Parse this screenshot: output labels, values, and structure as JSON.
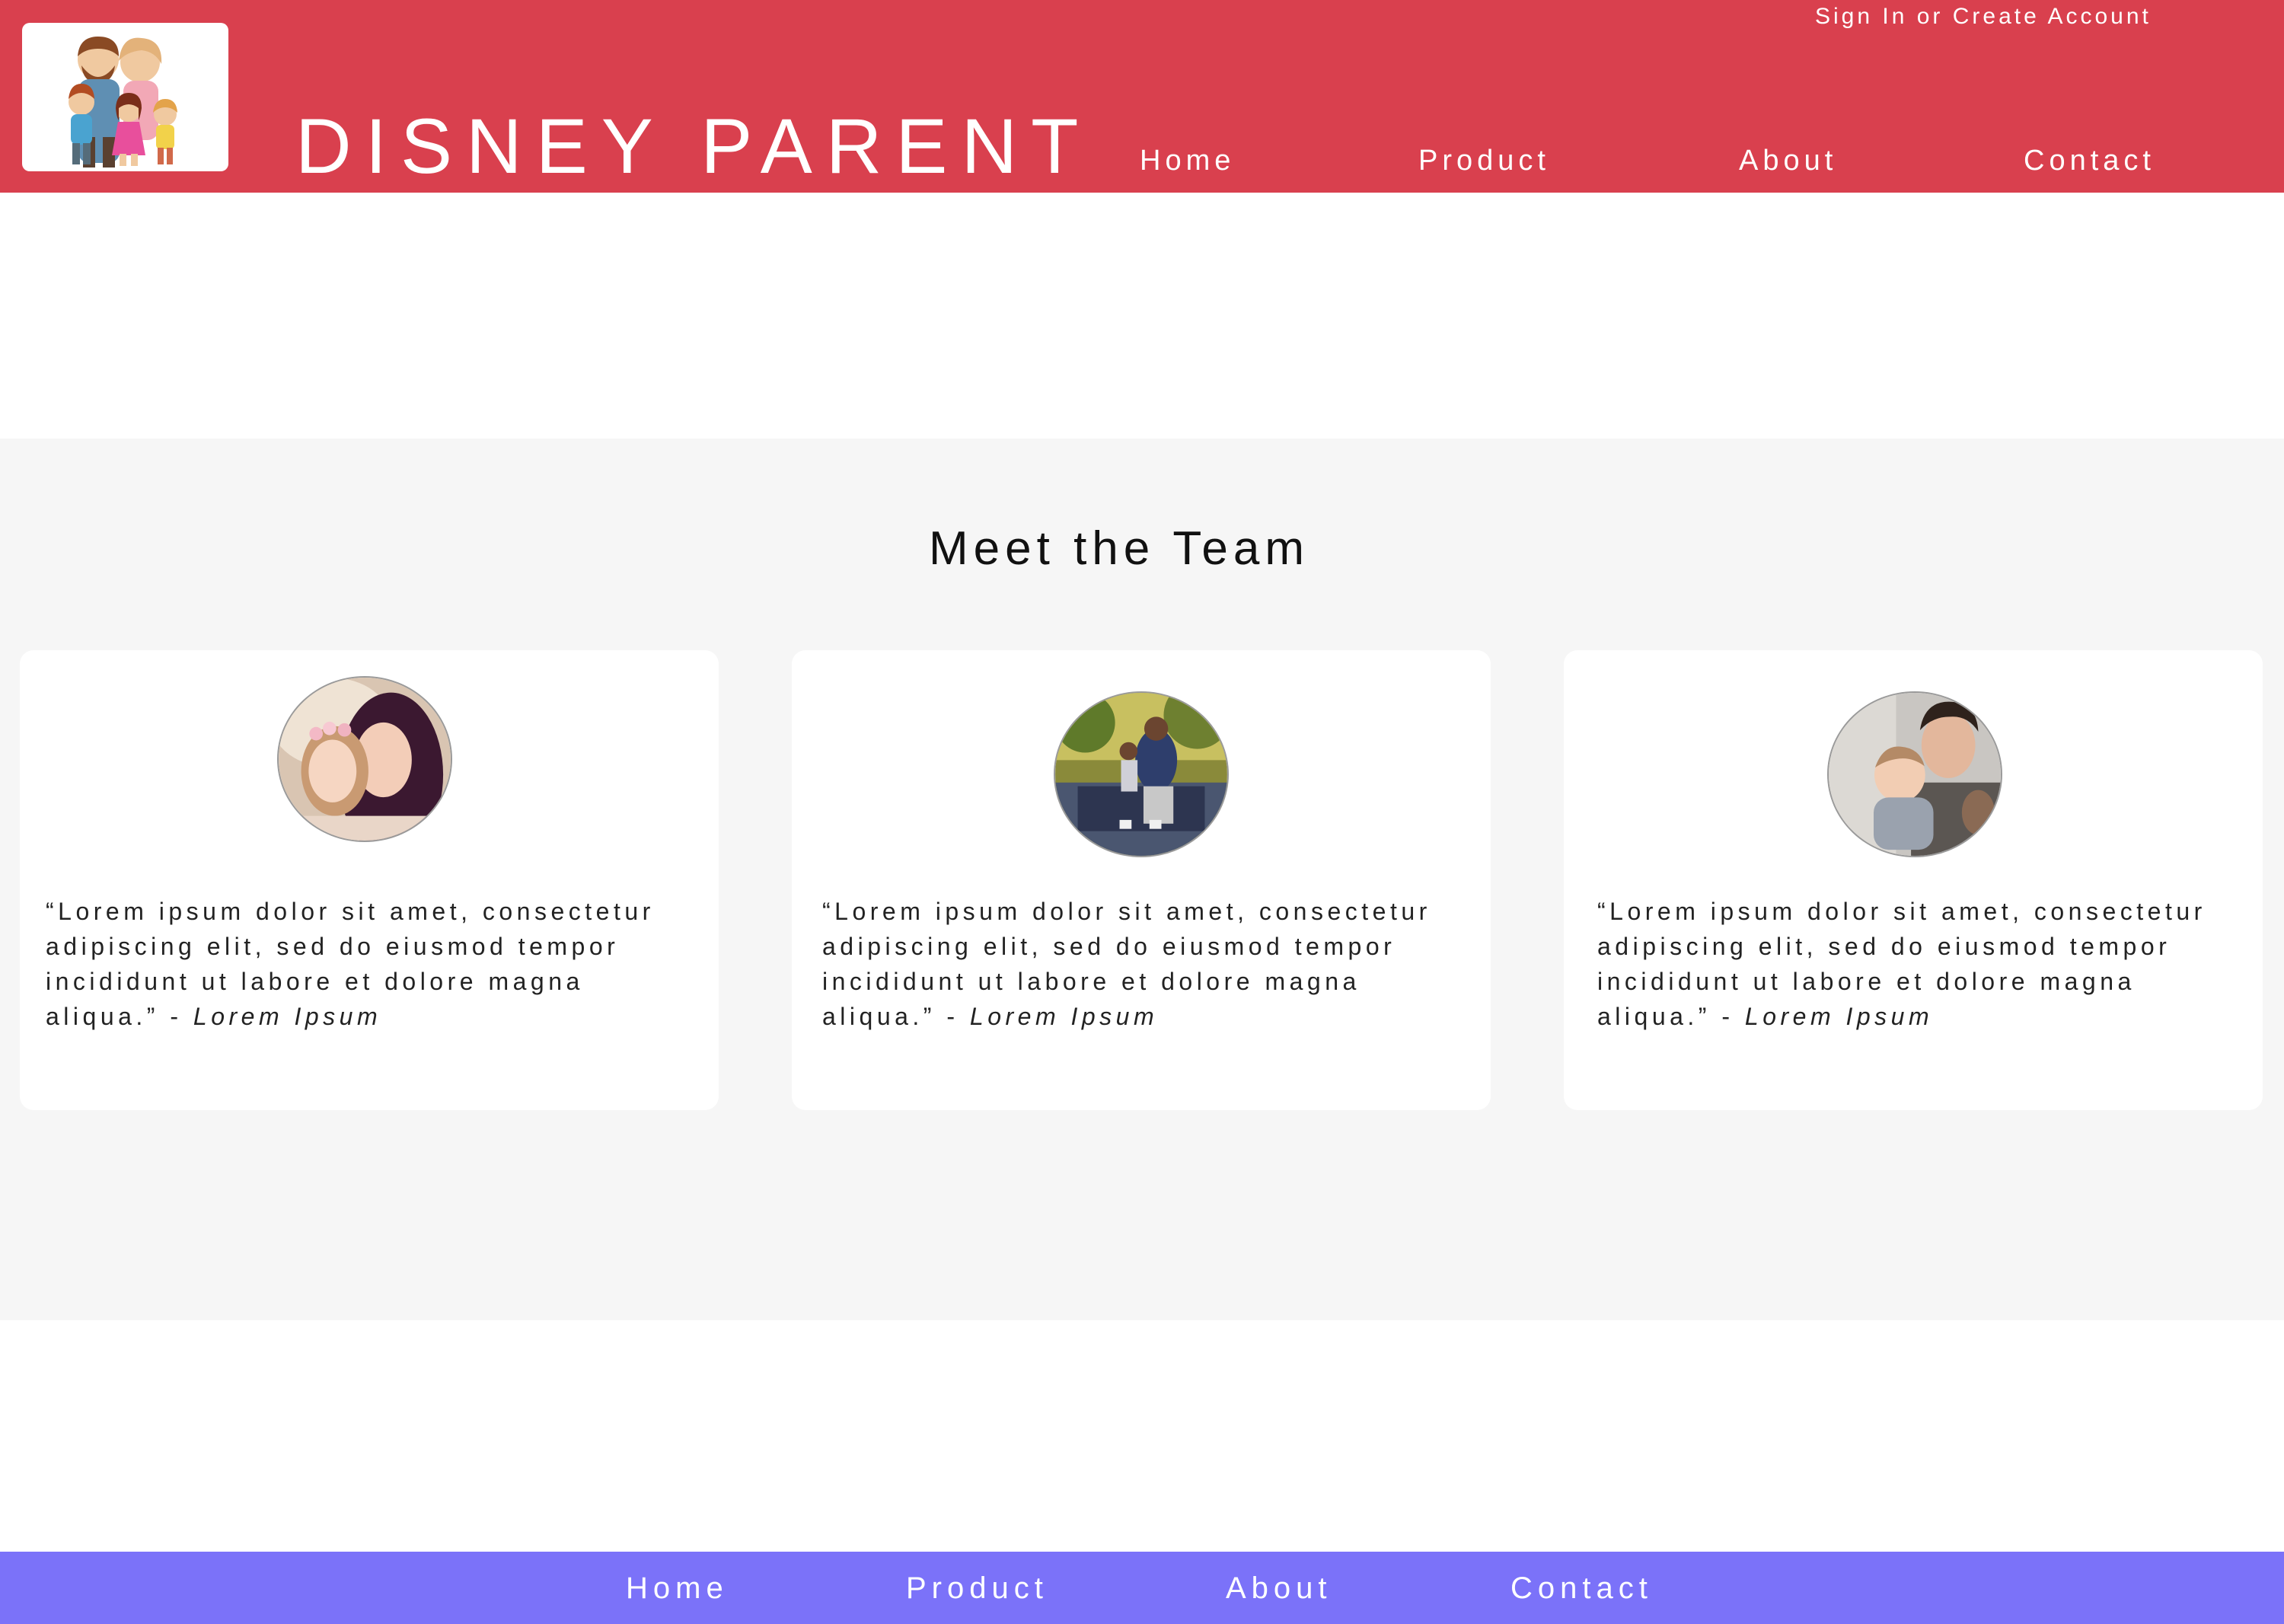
{
  "header": {
    "logo_icon": "family-cartoon-logo",
    "signin_label": "Sign In or Create Account",
    "brand": "DISNEY PARENT",
    "nav": [
      {
        "label": "Home"
      },
      {
        "label": "Product"
      },
      {
        "label": "About"
      },
      {
        "label": "Contact"
      }
    ],
    "background_color": "#d9404e"
  },
  "team": {
    "title": "Meet the Team",
    "background_color": "#f6f6f6",
    "members": [
      {
        "photo": "mother-and-daughter-photo",
        "quote": "“Lorem ipsum dolor sit amet, consectetur adipiscing elit, sed do eiusmod tempor incididunt ut labore et dolore magna aliqua.” -",
        "author": "Lorem Ipsum"
      },
      {
        "photo": "father-and-child-on-bench-photo",
        "quote": "“Lorem ipsum dolor sit amet, consectetur adipiscing elit, sed do eiusmod tempor incididunt ut labore et dolore magna aliqua.” -",
        "author": "Lorem Ipsum"
      },
      {
        "photo": "father-holding-baby-photo",
        "quote": "“Lorem ipsum dolor sit amet, consectetur adipiscing elit, sed do eiusmod tempor incididunt ut labore et dolore magna aliqua.” -",
        "author": "Lorem Ipsum"
      }
    ]
  },
  "footer": {
    "nav": [
      {
        "label": "Home"
      },
      {
        "label": "Product"
      },
      {
        "label": "About"
      },
      {
        "label": "Contact"
      }
    ],
    "background_color": "#7b72f9"
  }
}
